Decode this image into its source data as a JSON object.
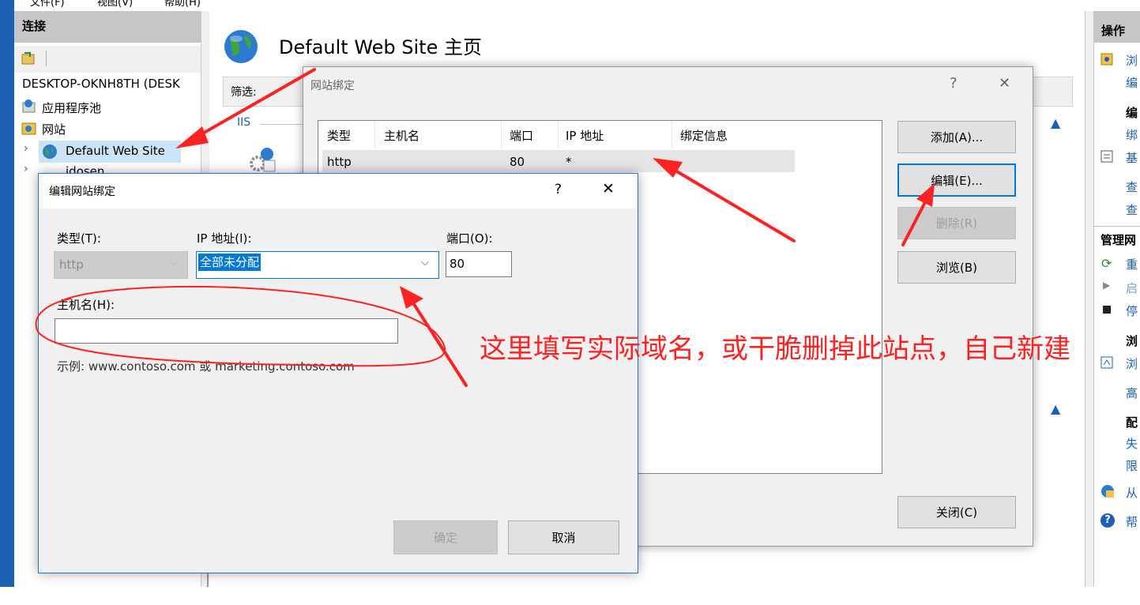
{
  "menubar": {
    "items": [
      "文件(F)",
      "视图(V)",
      "帮助(H)"
    ]
  },
  "connections": {
    "title": "连接",
    "tree": [
      {
        "label": "DESKTOP-OKNH8TH (DESK"
      },
      {
        "label": "应用程序池"
      },
      {
        "label": "网站"
      },
      {
        "label": "Default Web Site"
      },
      {
        "label": "idosen"
      }
    ]
  },
  "main": {
    "title": "Default Web Site 主页",
    "filter_label": "筛选:",
    "group_label": "IIS"
  },
  "actions": {
    "title": "操作",
    "items": [
      "浏",
      "编",
      "编",
      "绑",
      "基",
      "查",
      "查",
      "管理网",
      "重",
      "启",
      "停",
      "浏",
      "浏",
      "高",
      "配",
      "失",
      "限",
      "从",
      "帮"
    ]
  },
  "bindings_dialog": {
    "title": "网站绑定",
    "help": "?",
    "close": "✕",
    "columns": [
      "类型",
      "主机名",
      "端口",
      "IP 地址",
      "绑定信息"
    ],
    "rows": [
      {
        "type": "http",
        "host": "",
        "port": "80",
        "ip": "*",
        "info": ""
      }
    ],
    "buttons": {
      "add": "添加(A)...",
      "edit": "编辑(E)...",
      "remove": "删除(R)",
      "browse": "浏览(B)",
      "close": "关闭(C)"
    }
  },
  "edit_dialog": {
    "title": "编辑网站绑定",
    "help": "?",
    "close": "✕",
    "type_label": "类型(T):",
    "type_value": "http",
    "ip_label": "IP 地址(I):",
    "ip_value": "全部未分配",
    "port_label": "端口(O):",
    "port_value": "80",
    "host_label": "主机名(H):",
    "host_value": "",
    "example": "示例: www.contoso.com 或 marketing.contoso.com",
    "ok": "确定",
    "cancel": "取消"
  },
  "annotation": {
    "text": "这里填写实际域名，或干脆删掉此站点，自己新建",
    "color": "#ff2222"
  }
}
